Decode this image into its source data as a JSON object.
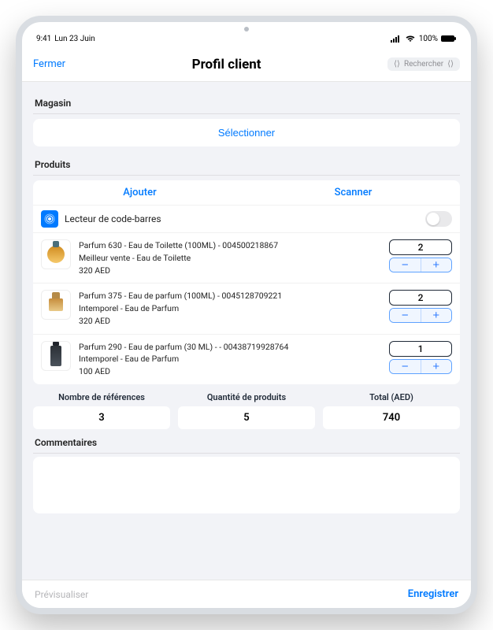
{
  "status": {
    "time": "9:41",
    "date": "Lun 23 Juin",
    "battery": "100%"
  },
  "nav": {
    "close": "Fermer",
    "title": "Profil client",
    "search": "Rechercher"
  },
  "sections": {
    "magasin_label": "Magasin",
    "select_label": "Sélectionner",
    "produits_label": "Produits",
    "commentaires_label": "Commentaires"
  },
  "tabs": {
    "add": "Ajouter",
    "scan": "Scanner"
  },
  "barcode": {
    "label": "Lecteur de code-barres",
    "enabled": false
  },
  "products": [
    {
      "line1": "Parfum 630 - Eau de Toilette (100ML) - 004500218867",
      "line2": "Meilleur vente  - Eau de Toilette",
      "price": "320 AED",
      "qty": "2",
      "bottle": "gold-round"
    },
    {
      "line1": "Parfum 375 - Eau de parfum (100ML) - 0045128709221",
      "line2": "Intemporel - Eau de Parfum",
      "price": "320 AED",
      "qty": "2",
      "bottle": "gold-sq"
    },
    {
      "line1": "Parfum 290 - Eau de parfum (30 ML) - - 00438719928764",
      "line2": "Intemporel  - Eau de Parfum",
      "price": "100 AED",
      "qty": "1",
      "bottle": "dark"
    }
  ],
  "summary": {
    "refs_label": "Nombre de références",
    "refs_value": "3",
    "qty_label": "Quantité de produits",
    "qty_value": "5",
    "total_label": "Total (AED)",
    "total_value": "740"
  },
  "footer": {
    "preview": "Prévisualiser",
    "save": "Enregistrer"
  },
  "glyphs": {
    "minus": "−",
    "plus": "+"
  }
}
